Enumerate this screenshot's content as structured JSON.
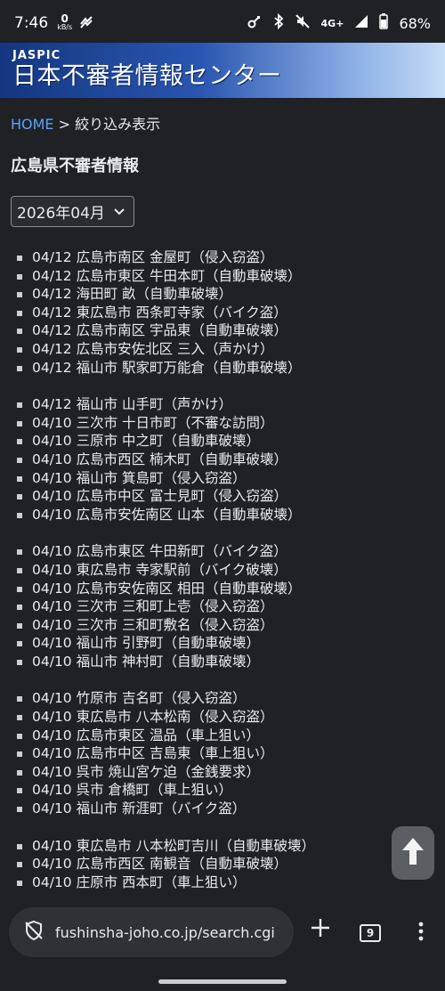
{
  "status": {
    "time": "7:46",
    "net_speed_value": "0",
    "net_speed_unit": "kB/s",
    "network": "4G+",
    "battery": "68%"
  },
  "header": {
    "brand_sub": "JASPIC",
    "brand_main": "日本不審者情報センター"
  },
  "breadcrumb": {
    "home": "HOME",
    "separator": " > ",
    "current": "絞り込み表示"
  },
  "page": {
    "title": "広島県不審者情報",
    "month_selected": "2026年04月"
  },
  "groups": [
    [
      "04/12 広島市南区 金屋町（侵入窃盗）",
      "04/12 広島市東区 牛田本町（自動車破壊）",
      "04/12 海田町 畝（自動車破壊）",
      "04/12 東広島市 西条町寺家（バイク盗）",
      "04/12 広島市南区 宇品東（自動車破壊）",
      "04/12 広島市安佐北区 三入（声かけ）",
      "04/12 福山市 駅家町万能倉（自動車破壊）"
    ],
    [
      "04/12 福山市 山手町（声かけ）",
      "04/10 三次市 十日市町（不審な訪問）",
      "04/10 三原市 中之町（自動車破壊）",
      "04/10 広島市西区 楠木町（自動車破壊）",
      "04/10 福山市 箕島町（侵入窃盗）",
      "04/10 広島市中区 富士見町（侵入窃盗）",
      "04/10 広島市安佐南区 山本（自動車破壊）"
    ],
    [
      "04/10 広島市東区 牛田新町（バイク盗）",
      "04/10 東広島市 寺家駅前（バイク破壊）",
      "04/10 広島市安佐南区 相田（自動車破壊）",
      "04/10 三次市 三和町上壱（侵入窃盗）",
      "04/10 三次市 三和町敷名（侵入窃盗）",
      "04/10 福山市 引野町（自動車破壊）",
      "04/10 福山市 神村町（自動車破壊）"
    ],
    [
      "04/10 竹原市 吉名町（侵入窃盗）",
      "04/10 東広島市 八本松南（侵入窃盗）",
      "04/10 広島市東区 温品（車上狙い）",
      "04/10 広島市中区 吉島東（車上狙い）",
      "04/10 呉市 焼山宮ケ迫（金銭要求）",
      "04/10 呉市 倉橋町（車上狙い）",
      "04/10 福山市 新涯町（バイク盗）"
    ],
    [
      "04/10 東広島市 八本松町吉川（自動車破壊）",
      "04/10 広島市西区 南観音（自動車破壊）",
      "04/10 庄原市 西本町（車上狙い）"
    ]
  ],
  "browser": {
    "url": "fushinsha-joho.co.jp/search.cgi",
    "tab_count": "9"
  }
}
